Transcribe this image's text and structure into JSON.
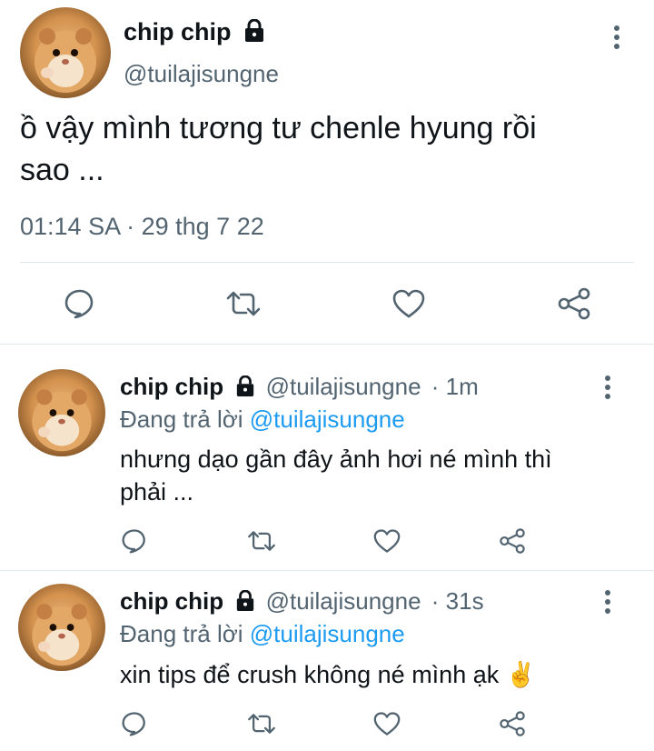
{
  "main_tweet": {
    "display_name": "chip chip",
    "handle": "@tuilajisungne",
    "text_line1": "ồ vậy mình tương tư chenle hyung rồi",
    "text_line2": "sao ...",
    "time": "01:14 SA",
    "separator": " · ",
    "date": "29 thg 7 22"
  },
  "replies": [
    {
      "display_name": "chip chip",
      "handle": "@tuilajisungne",
      "time_ago": "· 1m",
      "replying_prefix": "Đang trả lời ",
      "replying_to": "@tuilajisungne",
      "text_line1": "nhưng dạo gần đây ảnh hơi né mình thì",
      "text_line2": "phải ..."
    },
    {
      "display_name": "chip chip",
      "handle": "@tuilajisungne",
      "time_ago": "· 31s",
      "replying_prefix": "Đang trả lời ",
      "replying_to": "@tuilajisungne",
      "text_line1": "xin tips để crush không né mình ạk ✌"
    }
  ],
  "icons": {
    "reply": "reply-icon",
    "retweet": "retweet-icon",
    "like": "heart-icon",
    "share": "share-icon",
    "more": "more-vertical-icon",
    "lock": "lock-icon"
  },
  "colors": {
    "text": "#0f1419",
    "secondary": "#536471",
    "link": "#1d9bf0",
    "divider": "#e1e8ed"
  }
}
